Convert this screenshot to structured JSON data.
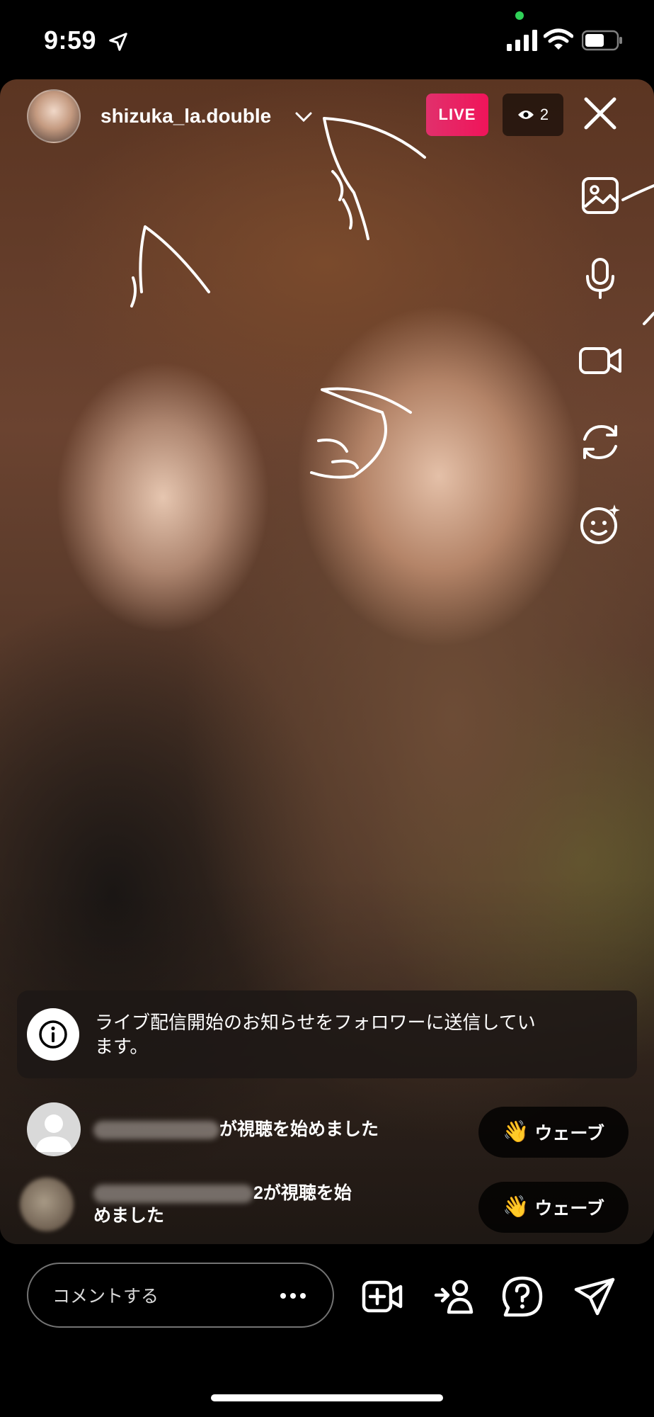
{
  "status_bar": {
    "time": "9:59"
  },
  "live_header": {
    "username": "shizuka_la.double",
    "live_label": "LIVE",
    "viewer_count": "2"
  },
  "side_tools": [
    "image-icon",
    "microphone-icon",
    "video-camera-icon",
    "switch-camera-icon",
    "effects-icon"
  ],
  "notice": {
    "text_line1": "ライブ配信開始のお知らせをフォロワーに送信してい",
    "text_line2": "ます。"
  },
  "joins": [
    {
      "suffix": "が視聴を始めました",
      "wave_label": "ウェーブ",
      "wave_emoji": "👋"
    },
    {
      "suffix_line1": "2が視聴を始",
      "line2": "めました",
      "wave_label": "ウェーブ",
      "wave_emoji": "👋"
    }
  ],
  "bottom_bar": {
    "comment_placeholder": "コメントする"
  },
  "colors": {
    "live_badge": "#e1306c",
    "status_dot": "#30d158"
  }
}
